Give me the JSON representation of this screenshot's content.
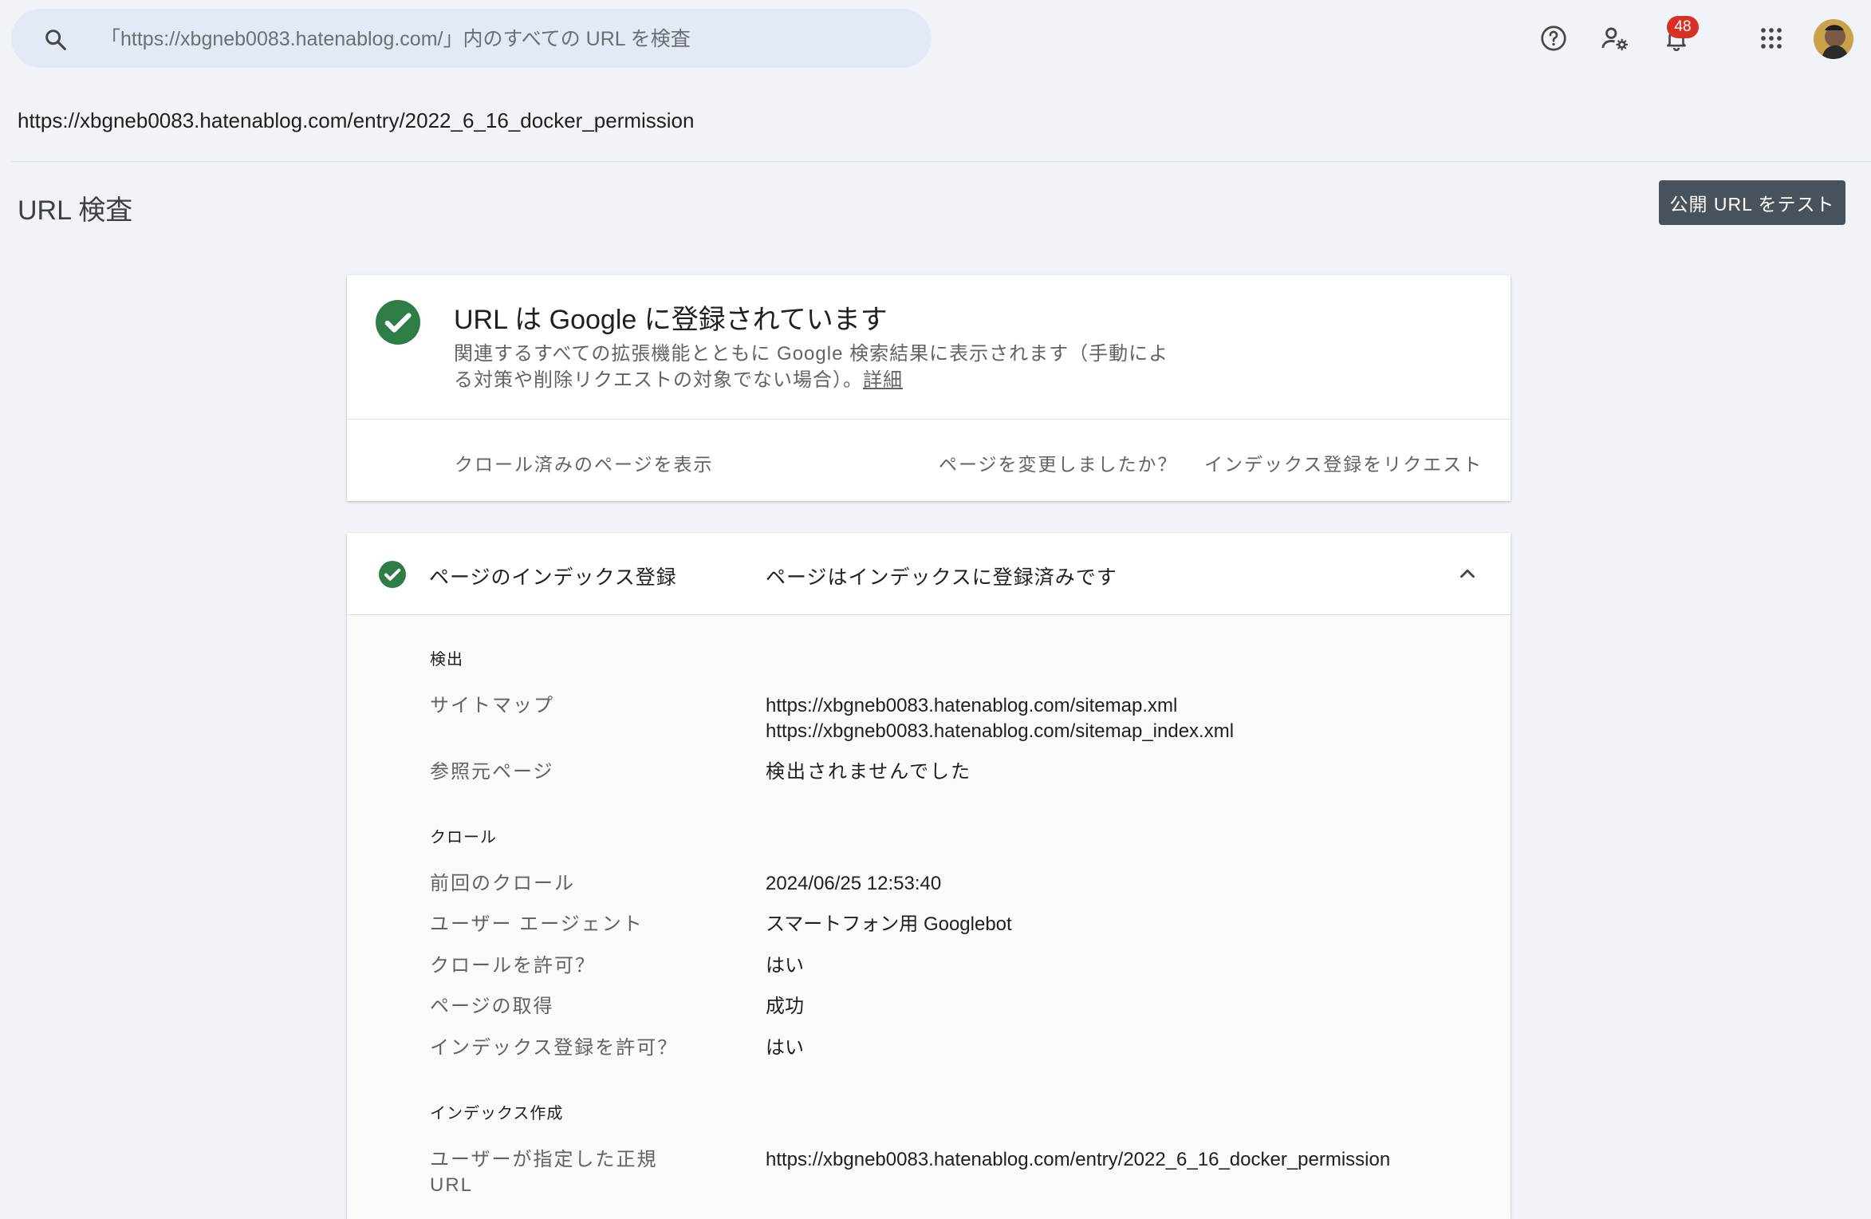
{
  "search": {
    "placeholder": "「https://xbgneb0083.hatenablog.com/」内のすべての URL を検査"
  },
  "topbar": {
    "icons": [
      "help-icon",
      "manage-users-icon",
      "notifications-icon",
      "apps-grid-icon"
    ],
    "notification_count": "48"
  },
  "inspected_url": "https://xbgneb0083.hatenablog.com/entry/2022_6_16_docker_permission",
  "page_title": "URL 検査",
  "test_button": "公開 URL をテスト",
  "status_card": {
    "title": "URL は Google に登録されています",
    "description": "関連するすべての拡張機能とともに Google 検索結果に表示されます（手動による対策や削除リクエストの対象でない場合）。",
    "details_link": "詳細",
    "view_crawled": "クロール済みのページを表示",
    "page_changed": "ページを変更しましたか？",
    "request_indexing": "インデックス登録をリクエスト",
    "accent_color": "#2e7d46"
  },
  "indexing_card": {
    "label": "ページのインデックス登録",
    "value": "ページはインデックスに登録済みです",
    "discovery": {
      "heading": "検出",
      "sitemap_label": "サイトマップ",
      "sitemaps": [
        "https://xbgneb0083.hatenablog.com/sitemap.xml",
        "https://xbgneb0083.hatenablog.com/sitemap_index.xml"
      ],
      "referring_label": "参照元ページ",
      "referring_value": "検出されませんでした"
    },
    "crawl": {
      "heading": "クロール",
      "rows": [
        {
          "label": "前回のクロール",
          "value": "2024/06/25 12:53:40"
        },
        {
          "label": "ユーザー エージェント",
          "value": "スマートフォン用 Googlebot"
        },
        {
          "label": "クロールを許可？",
          "value": "はい"
        },
        {
          "label": "ページの取得",
          "value": "成功"
        },
        {
          "label": "インデックス登録を許可？",
          "value": "はい"
        }
      ]
    },
    "indexing": {
      "heading": "インデックス作成",
      "canonical_label_line1": "ユーザーが指定した正規",
      "canonical_label_line2": "URL",
      "canonical_value": "https://xbgneb0083.hatenablog.com/entry/2022_6_16_docker_permission"
    }
  }
}
